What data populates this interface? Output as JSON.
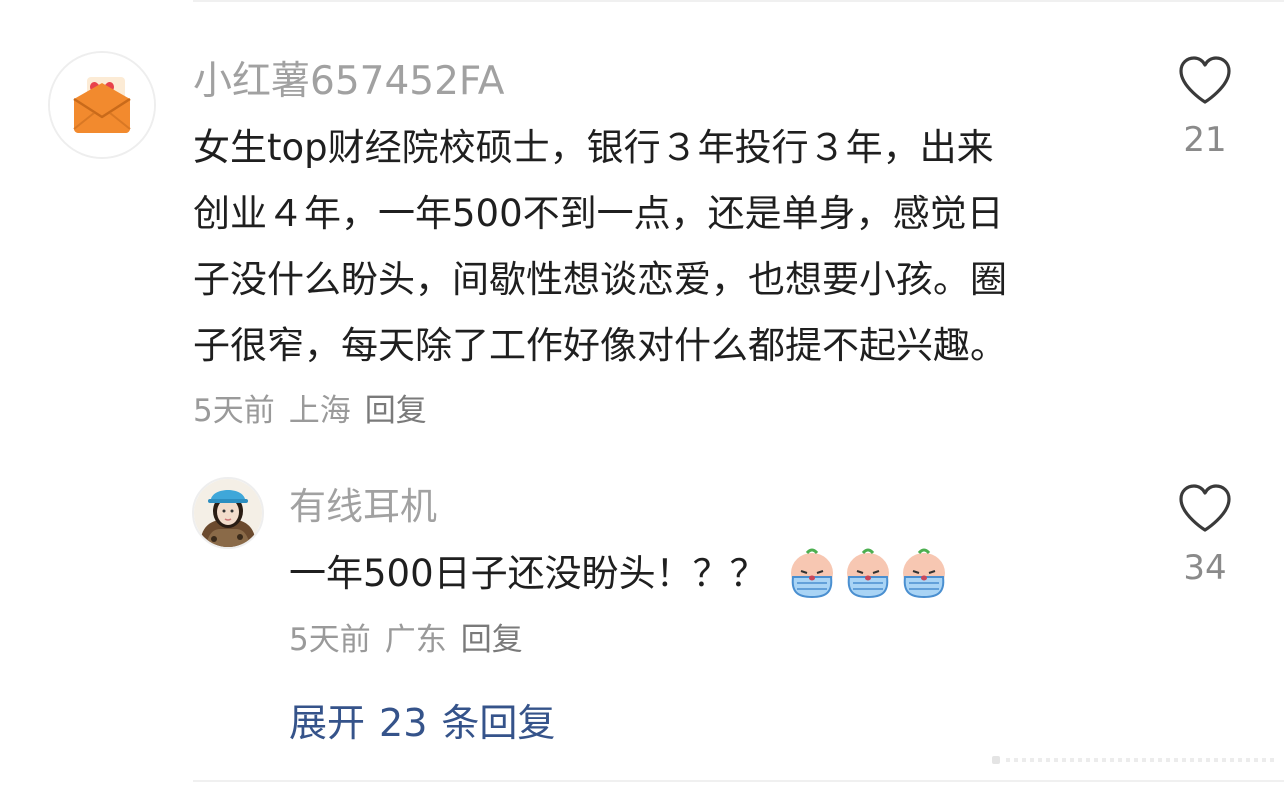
{
  "comment": {
    "username": "小红薯657452FA",
    "lines": [
      "女生top财经院校硕士，银行３年投行３年，出来",
      "创业４年，一年500不到一点，还是单身，感觉日",
      "子没什么盼头，间歇性想谈恋爱，也想要小孩。圈",
      "子很窄，每天除了工作好像对什么都提不起兴趣。"
    ],
    "time": "5天前",
    "location": "上海",
    "reply_label": "回复",
    "likes": "21"
  },
  "reply": {
    "username": "有线耳机",
    "text": "一年500日子还没盼头！？？",
    "emoji_icons": [
      "crying-face-emoji",
      "crying-face-emoji",
      "crying-face-emoji"
    ],
    "time": "5天前",
    "location": "广东",
    "reply_label": "回复",
    "likes": "34"
  },
  "expand": {
    "prefix": "展开",
    "count": "23",
    "suffix": "条回复"
  },
  "colors": {
    "text": "#1f1f1f",
    "username": "#a1a1a1",
    "meta": "#9a9a9a",
    "link": "#35538a",
    "avatar_orange": "#f28a2e",
    "heart_red": "#e8424b"
  }
}
